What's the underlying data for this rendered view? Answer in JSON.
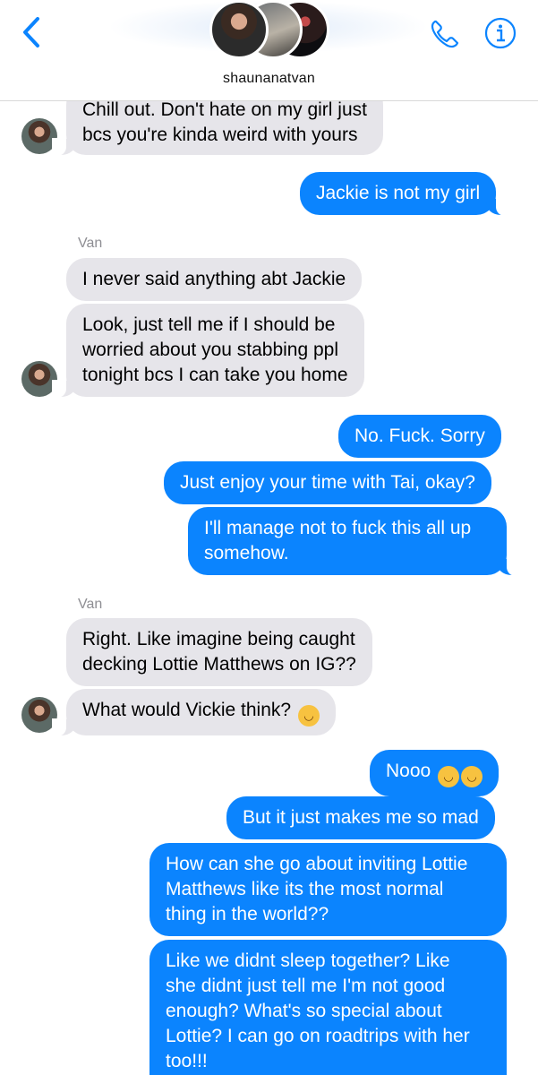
{
  "header": {
    "contact_name": "shaunanatvan",
    "back_icon": "chevron-left-icon",
    "call_icon": "phone-icon",
    "info_icon": "info-icon",
    "accent_color": "#0b84fe"
  },
  "messages": [
    {
      "from": "them",
      "lines": [
        "Chill out. Don't hate on my girl just",
        "bcs you're kinda weird with yours"
      ]
    },
    {
      "from": "me",
      "lines": [
        "Jackie is not my girl"
      ]
    },
    {
      "sender_label": "Van"
    },
    {
      "from": "them",
      "lines": [
        "I never said anything abt Jackie"
      ]
    },
    {
      "from": "them",
      "lines": [
        "Look, just tell me if I should be",
        "worried about you stabbing ppl",
        "tonight bcs I can take you home"
      ]
    },
    {
      "from": "me",
      "lines": [
        "No. Fuck. Sorry"
      ]
    },
    {
      "from": "me",
      "lines": [
        "Just enjoy your time with Tai, okay?"
      ]
    },
    {
      "from": "me",
      "lines": [
        "I'll manage not to fuck this all up",
        "somehow."
      ]
    },
    {
      "sender_label": "Van"
    },
    {
      "from": "them",
      "lines": [
        "Right. Like imagine being caught",
        "decking Lottie Matthews on IG??"
      ]
    },
    {
      "from": "them",
      "lines": [
        "What would Vickie think?"
      ],
      "emoji": "😭"
    },
    {
      "from": "me",
      "lines": [
        "Nooo"
      ],
      "emoji": "😭😭"
    },
    {
      "from": "me",
      "lines": [
        "But it just makes me so mad"
      ]
    },
    {
      "from": "me",
      "lines": [
        "How can she go about inviting Lottie",
        "Matthews like its the most normal",
        "thing in the world??"
      ]
    },
    {
      "from": "me",
      "lines": [
        "Like we didnt sleep together? Like",
        "she didnt just  tell me I'm not good",
        "enough? What's so special about",
        "Lottie? I can go on roadtrips with her",
        "too!!!"
      ]
    }
  ],
  "colors": {
    "sent_bubble": "#0b84fe",
    "received_bubble": "#e6e5ea",
    "sender_label": "#8e8e93"
  }
}
